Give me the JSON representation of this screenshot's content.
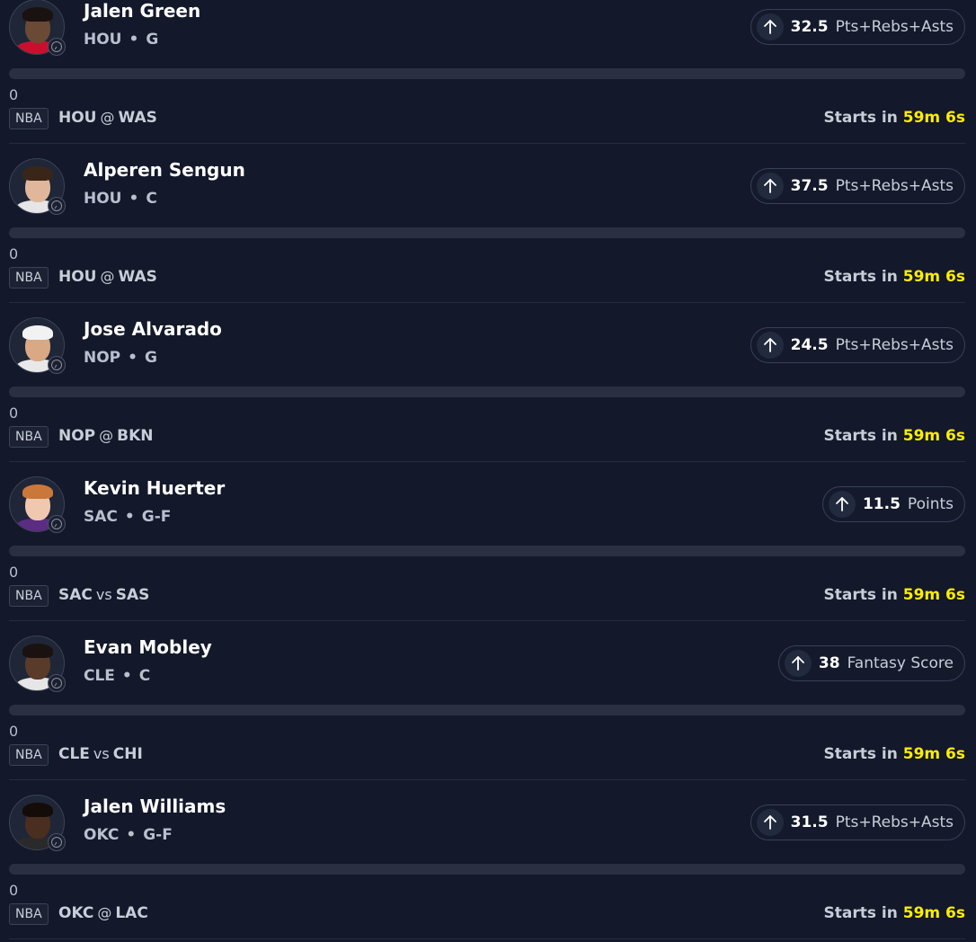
{
  "colors": {
    "background": "#13182a",
    "timer": "#ffee00",
    "progress_track": "#2a3042"
  },
  "cards": [
    {
      "name": "Jalen Green",
      "team": "HOU",
      "position": "G",
      "line": "32.5",
      "stat": "Pts+Rebs+Asts",
      "progress_value": "0",
      "league": "NBA",
      "home": "HOU",
      "separator": "@",
      "away": "WAS",
      "starts_label": "Starts in",
      "countdown": "59m 6s",
      "avatar": {
        "skin": "#6b4a35",
        "hair": "#1a1210",
        "jersey": "#c8102e"
      }
    },
    {
      "name": "Alperen Sengun",
      "team": "HOU",
      "position": "C",
      "line": "37.5",
      "stat": "Pts+Rebs+Asts",
      "progress_value": "0",
      "league": "NBA",
      "home": "HOU",
      "separator": "@",
      "away": "WAS",
      "starts_label": "Starts in",
      "countdown": "59m 6s",
      "avatar": {
        "skin": "#e0b79a",
        "hair": "#3a2618",
        "jersey": "#e6e6e6"
      }
    },
    {
      "name": "Jose Alvarado",
      "team": "NOP",
      "position": "G",
      "line": "24.5",
      "stat": "Pts+Rebs+Asts",
      "progress_value": "0",
      "league": "NBA",
      "home": "NOP",
      "separator": "@",
      "away": "BKN",
      "starts_label": "Starts in",
      "countdown": "59m 6s",
      "avatar": {
        "skin": "#d9a884",
        "hair": "#f2f2f2",
        "jersey": "#e8e8e8"
      }
    },
    {
      "name": "Kevin Huerter",
      "team": "SAC",
      "position": "G-F",
      "line": "11.5",
      "stat": "Points",
      "progress_value": "0",
      "league": "NBA",
      "home": "SAC",
      "separator": "vs",
      "away": "SAS",
      "starts_label": "Starts in",
      "countdown": "59m 6s",
      "avatar": {
        "skin": "#f0c8b0",
        "hair": "#c9783a",
        "jersey": "#5a2d82"
      }
    },
    {
      "name": "Evan Mobley",
      "team": "CLE",
      "position": "C",
      "line": "38",
      "stat": "Fantasy Score",
      "progress_value": "0",
      "league": "NBA",
      "home": "CLE",
      "separator": "vs",
      "away": "CHI",
      "starts_label": "Starts in",
      "countdown": "59m 6s",
      "avatar": {
        "skin": "#5a3a28",
        "hair": "#1a1210",
        "jersey": "#e6e6e6"
      }
    },
    {
      "name": "Jalen Williams",
      "team": "OKC",
      "position": "G-F",
      "line": "31.5",
      "stat": "Pts+Rebs+Asts",
      "progress_value": "0",
      "league": "NBA",
      "home": "OKC",
      "separator": "@",
      "away": "LAC",
      "starts_label": "Starts in",
      "countdown": "59m 6s",
      "avatar": {
        "skin": "#4a2e20",
        "hair": "#140c08",
        "jersey": "#2a2a2a"
      }
    }
  ]
}
